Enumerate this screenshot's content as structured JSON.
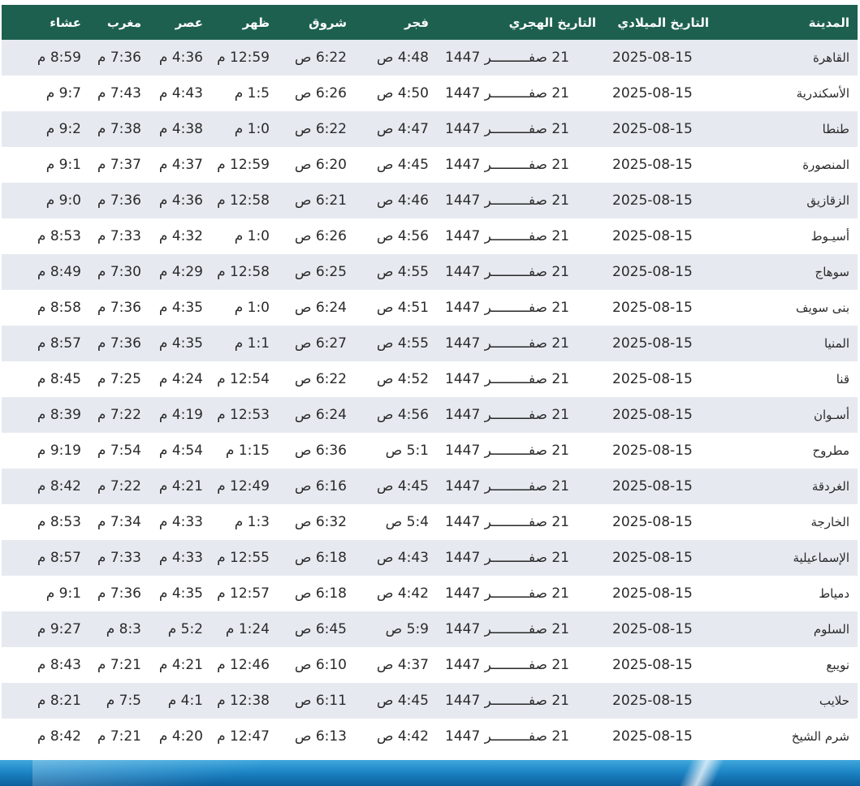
{
  "headers": [
    "المدينة",
    "التاريخ الميلادي",
    "التاريخ الهجري",
    "فجر",
    "شروق",
    "ظهر",
    "عصر",
    "مغرب",
    "عشاء"
  ],
  "rows": [
    [
      "القاهرة",
      "2025-08-15",
      "21 صفـــــــــر 1447",
      "4:48 ص",
      "6:22 ص",
      "12:59 م",
      "4:36 م",
      "7:36 م",
      "8:59 م"
    ],
    [
      "الأسكندرية",
      "2025-08-15",
      "21 صفـــــــــر 1447",
      "4:50 ص",
      "6:26 ص",
      "1:5 م",
      "4:43 م",
      "7:43 م",
      "9:7 م"
    ],
    [
      "طنطا",
      "2025-08-15",
      "21 صفـــــــــر 1447",
      "4:47 ص",
      "6:22 ص",
      "1:0 م",
      "4:38 م",
      "7:38 م",
      "9:2 م"
    ],
    [
      "المنصورة",
      "2025-08-15",
      "21 صفـــــــــر 1447",
      "4:45 ص",
      "6:20 ص",
      "12:59 م",
      "4:37 م",
      "7:37 م",
      "9:1 م"
    ],
    [
      "الزقازيق",
      "2025-08-15",
      "21 صفـــــــــر 1447",
      "4:46 ص",
      "6:21 ص",
      "12:58 م",
      "4:36 م",
      "7:36 م",
      "9:0 م"
    ],
    [
      "أسيـوط",
      "2025-08-15",
      "21 صفـــــــــر 1447",
      "4:56 ص",
      "6:26 ص",
      "1:0 م",
      "4:32 م",
      "7:33 م",
      "8:53 م"
    ],
    [
      "سوهاج",
      "2025-08-15",
      "21 صفـــــــــر 1447",
      "4:55 ص",
      "6:25 ص",
      "12:58 م",
      "4:29 م",
      "7:30 م",
      "8:49 م"
    ],
    [
      "بنى سويف",
      "2025-08-15",
      "21 صفـــــــــر 1447",
      "4:51 ص",
      "6:24 ص",
      "1:0 م",
      "4:35 م",
      "7:36 م",
      "8:58 م"
    ],
    [
      "المنيا",
      "2025-08-15",
      "21 صفـــــــــر 1447",
      "4:55 ص",
      "6:27 ص",
      "1:1 م",
      "4:35 م",
      "7:36 م",
      "8:57 م"
    ],
    [
      "قنا",
      "2025-08-15",
      "21 صفـــــــــر 1447",
      "4:52 ص",
      "6:22 ص",
      "12:54 م",
      "4:24 م",
      "7:25 م",
      "8:45 م"
    ],
    [
      "أسـوان",
      "2025-08-15",
      "21 صفـــــــــر 1447",
      "4:56 ص",
      "6:24 ص",
      "12:53 م",
      "4:19 م",
      "7:22 م",
      "8:39 م"
    ],
    [
      "مطروح",
      "2025-08-15",
      "21 صفـــــــــر 1447",
      "5:1 ص",
      "6:36 ص",
      "1:15 م",
      "4:54 م",
      "7:54 م",
      "9:19 م"
    ],
    [
      "الغردقة",
      "2025-08-15",
      "21 صفـــــــــر 1447",
      "4:45 ص",
      "6:16 ص",
      "12:49 م",
      "4:21 م",
      "7:22 م",
      "8:42 م"
    ],
    [
      "الخارجة",
      "2025-08-15",
      "21 صفـــــــــر 1447",
      "5:4 ص",
      "6:32 ص",
      "1:3 م",
      "4:33 م",
      "7:34 م",
      "8:53 م"
    ],
    [
      "الإسماعيلية",
      "2025-08-15",
      "21 صفـــــــــر 1447",
      "4:43 ص",
      "6:18 ص",
      "12:55 م",
      "4:33 م",
      "7:33 م",
      "8:57 م"
    ],
    [
      "دمياط",
      "2025-08-15",
      "21 صفـــــــــر 1447",
      "4:42 ص",
      "6:18 ص",
      "12:57 م",
      "4:35 م",
      "7:36 م",
      "9:1 م"
    ],
    [
      "السلوم",
      "2025-08-15",
      "21 صفـــــــــر 1447",
      "5:9 ص",
      "6:45 ص",
      "1:24 م",
      "5:2 م",
      "8:3 م",
      "9:27 م"
    ],
    [
      "نويبع",
      "2025-08-15",
      "21 صفـــــــــر 1447",
      "4:37 ص",
      "6:10 ص",
      "12:46 م",
      "4:21 م",
      "7:21 م",
      "8:43 م"
    ],
    [
      "حلايب",
      "2025-08-15",
      "21 صفـــــــــر 1447",
      "4:45 ص",
      "6:11 ص",
      "12:38 م",
      "4:1 م",
      "7:5 م",
      "8:21 م"
    ],
    [
      "شرم الشيخ",
      "2025-08-15",
      "21 صفـــــــــر 1447",
      "4:42 ص",
      "6:13 ص",
      "12:47 م",
      "4:20 م",
      "7:21 م",
      "8:42 م"
    ]
  ],
  "colors": {
    "header_bg": "#1d6050",
    "row_alt": "#e6eaf0",
    "banner": "#1d86c6"
  }
}
